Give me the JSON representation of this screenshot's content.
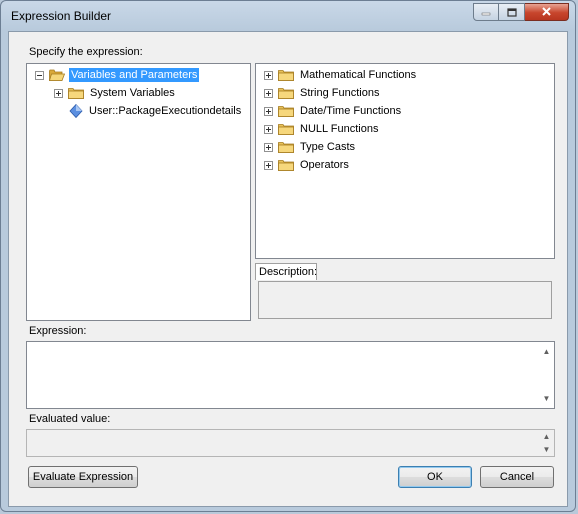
{
  "window": {
    "title": "Expression Builder",
    "controls": {
      "minimize": "minimize",
      "maximize": "maximize",
      "close": "close"
    }
  },
  "labels": {
    "specify_expression": "Specify the expression:",
    "description": "Description:",
    "expression": "Expression:",
    "evaluated_value": "Evaluated value:"
  },
  "variables_tree": {
    "root": "Variables and Parameters",
    "children": [
      "System Variables",
      "User::PackageExecutiondetails"
    ]
  },
  "functions_tree": {
    "items": [
      "Mathematical Functions",
      "String Functions",
      "Date/Time Functions",
      "NULL Functions",
      "Type Casts",
      "Operators"
    ]
  },
  "buttons": {
    "evaluate": "Evaluate Expression",
    "ok": "OK",
    "cancel": "Cancel"
  },
  "icons": {
    "folder_color": "#e8c25a",
    "variable_color": "#4a7fd6",
    "selection_color": "#3399ff"
  }
}
